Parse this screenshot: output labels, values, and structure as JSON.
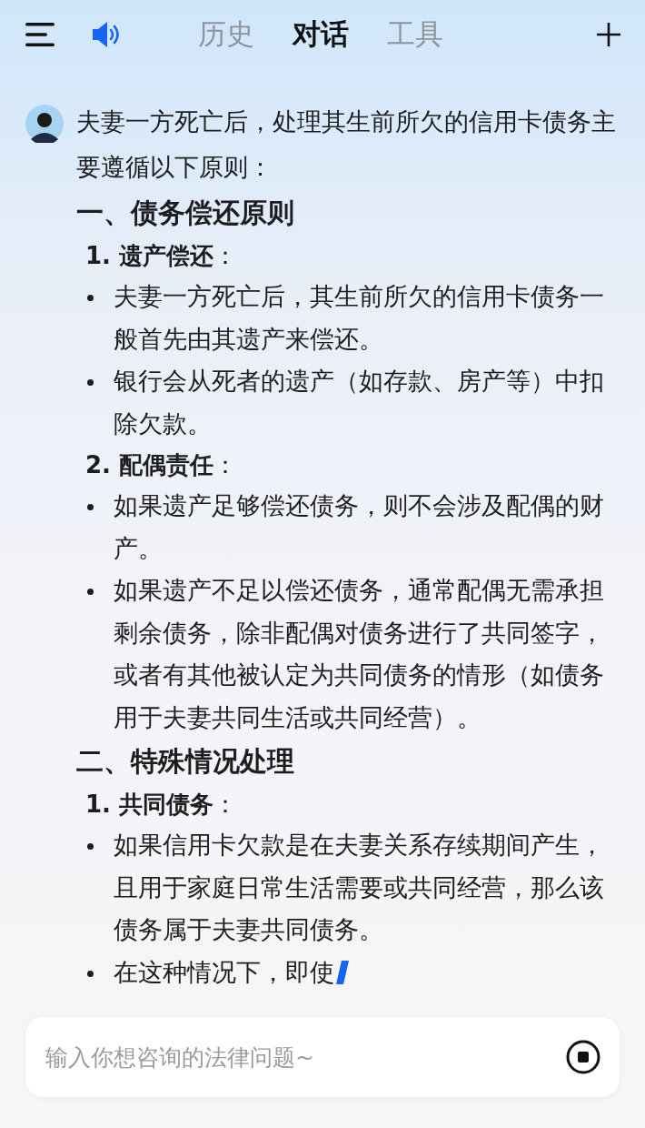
{
  "header": {
    "tabs": [
      {
        "label": "历史",
        "selected": false
      },
      {
        "label": "对话",
        "selected": true
      },
      {
        "label": "工具",
        "selected": false
      }
    ]
  },
  "answer": {
    "intro": "夫妻一方死亡后，处理其生前所欠的信用卡债务主要遵循以下原则：",
    "sections": [
      {
        "heading": "一、债务偿还原则",
        "items": [
          {
            "label": "**1. 遗产偿还**：",
            "bullets": [
              {
                "text": "夫妻一方死亡后，其生前所欠的信用卡债务一般首先由其遗产来偿还。",
                "cursor": false
              },
              {
                "text": "银行会从死者的遗产（如存款、房产等）中扣除欠款。",
                "cursor": false
              }
            ]
          },
          {
            "label": "**2. 配偶责任**：",
            "bullets": [
              {
                "text": "如果遗产足够偿还债务，则不会涉及配偶的财产。",
                "cursor": false
              },
              {
                "text": "如果遗产不足以偿还债务，通常配偶无需承担剩余债务，除非配偶对债务进行了共同签字，或者有其他被认定为共同债务的情形（如债务用于夫妻共同生活或共同经营）。",
                "cursor": false
              }
            ]
          }
        ]
      },
      {
        "heading": "二、特殊情况处理",
        "items": [
          {
            "label": "**1. 共同债务**：",
            "bullets": [
              {
                "text": "如果信用卡欠款是在夫妻关系存续期间产生，且用于家庭日常生活需要或共同经营，那么该债务属于夫妻共同债务。",
                "cursor": false
              },
              {
                "text": "在这种情况下，即使",
                "cursor": true
              }
            ]
          }
        ]
      }
    ]
  },
  "input": {
    "placeholder": "输入你想咨询的法律问题~"
  }
}
